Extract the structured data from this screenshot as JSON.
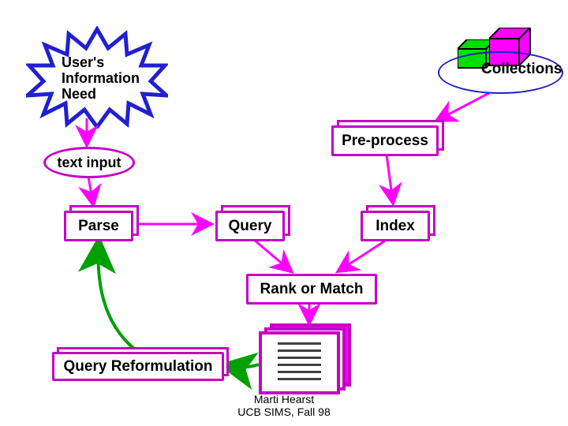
{
  "nodes": {
    "user_need": "User's\nInformation\nNeed",
    "collections": "Collections",
    "preprocess": "Pre-process",
    "text_input": "text input",
    "parse": "Parse",
    "query": "Query",
    "index": "Index",
    "rank": "Rank or Match",
    "reformulation": "Query Reformulation"
  },
  "footer": {
    "line1": "Marti Hearst",
    "line2": "UCB SIMS, Fall 98"
  },
  "chart_data": {
    "type": "diagram",
    "title": "Information Retrieval Process Flow",
    "nodes": [
      {
        "id": "user_need",
        "label": "User's Information Need",
        "shape": "starburst"
      },
      {
        "id": "collections",
        "label": "Collections",
        "shape": "oval_with_cubes"
      },
      {
        "id": "text_input",
        "label": "text input",
        "shape": "oval"
      },
      {
        "id": "preprocess",
        "label": "Pre-process",
        "shape": "box3d"
      },
      {
        "id": "parse",
        "label": "Parse",
        "shape": "box3d"
      },
      {
        "id": "query",
        "label": "Query",
        "shape": "box3d"
      },
      {
        "id": "index",
        "label": "Index",
        "shape": "box3d"
      },
      {
        "id": "rank",
        "label": "Rank or Match",
        "shape": "box"
      },
      {
        "id": "results",
        "label": "(result documents)",
        "shape": "stack"
      },
      {
        "id": "reformulation",
        "label": "Query Reformulation",
        "shape": "box3d"
      }
    ],
    "edges": [
      {
        "from": "user_need",
        "to": "text_input",
        "color": "magenta"
      },
      {
        "from": "collections",
        "to": "preprocess",
        "color": "magenta"
      },
      {
        "from": "text_input",
        "to": "parse",
        "color": "magenta"
      },
      {
        "from": "preprocess",
        "to": "index",
        "color": "magenta"
      },
      {
        "from": "parse",
        "to": "query",
        "color": "magenta"
      },
      {
        "from": "query",
        "to": "rank",
        "color": "magenta"
      },
      {
        "from": "index",
        "to": "rank",
        "color": "magenta"
      },
      {
        "from": "rank",
        "to": "results",
        "color": "magenta"
      },
      {
        "from": "results",
        "to": "reformulation",
        "color": "green",
        "style": "feedback"
      },
      {
        "from": "reformulation",
        "to": "parse",
        "color": "green",
        "style": "feedback"
      }
    ]
  }
}
